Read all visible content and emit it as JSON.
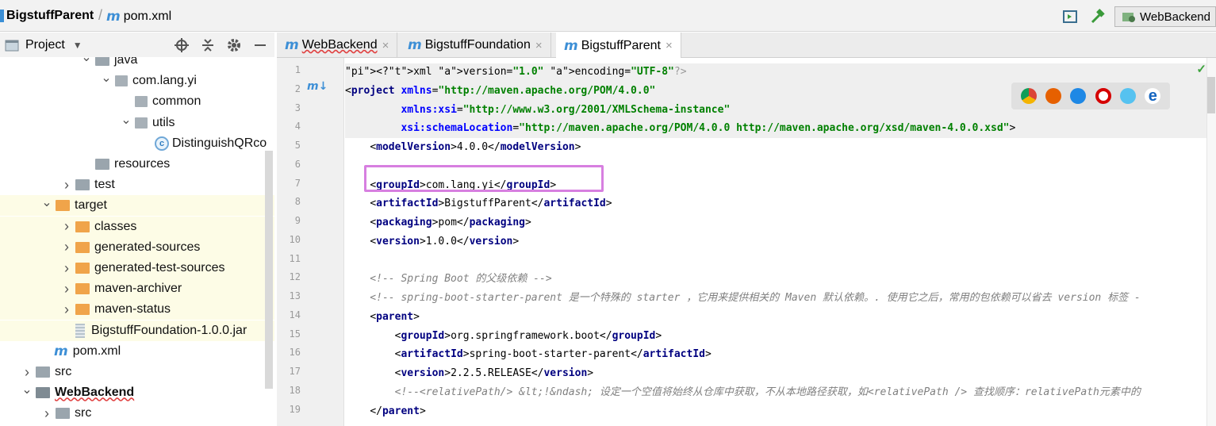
{
  "breadcrumb": {
    "project": "BigstuffParent",
    "file": "pom.xml"
  },
  "toolbar": {
    "run_config": "WebBackend"
  },
  "project_panel": {
    "title": "Project"
  },
  "tree": [
    {
      "label": "java",
      "icon": "source-folder-icon",
      "arrow": "expanded",
      "indent": 0
    },
    {
      "label": "com.lang.yi",
      "icon": "package-icon",
      "arrow": "expanded",
      "indent": 1
    },
    {
      "label": "common",
      "icon": "package-icon",
      "arrow": "none",
      "indent": 2
    },
    {
      "label": "utils",
      "icon": "package-icon",
      "arrow": "expanded",
      "indent": 2
    },
    {
      "label": "DistinguishQRco",
      "icon": "class-icon",
      "arrow": "none",
      "indent": 3
    },
    {
      "label": "resources",
      "icon": "resources-folder-icon",
      "arrow": "none",
      "indent": 0
    },
    {
      "label": "test",
      "icon": "folder-icon",
      "arrow": "collapsed",
      "indent": -1
    },
    {
      "label": "target",
      "icon": "orange-folder-icon",
      "arrow": "expanded",
      "indent": -2
    },
    {
      "label": "classes",
      "icon": "orange-folder-icon",
      "arrow": "collapsed",
      "indent": -1
    },
    {
      "label": "generated-sources",
      "icon": "orange-folder-icon",
      "arrow": "collapsed",
      "indent": -1
    },
    {
      "label": "generated-test-sources",
      "icon": "orange-folder-icon",
      "arrow": "collapsed",
      "indent": -1
    },
    {
      "label": "maven-archiver",
      "icon": "orange-folder-icon",
      "arrow": "collapsed",
      "indent": -1
    },
    {
      "label": "maven-status",
      "icon": "orange-folder-icon",
      "arrow": "collapsed",
      "indent": -1
    },
    {
      "label": "BigstuffFoundation-1.0.0.jar",
      "icon": "jar-icon",
      "arrow": "none",
      "indent": -1
    },
    {
      "label": "pom.xml",
      "icon": "maven-icon",
      "arrow": "none",
      "indent": -2
    },
    {
      "label": "src",
      "icon": "folder-icon",
      "arrow": "collapsed",
      "indent": -3
    },
    {
      "label": "WebBackend",
      "icon": "module-icon",
      "arrow": "expanded",
      "indent": -3
    },
    {
      "label": "src",
      "icon": "folder-icon",
      "arrow": "collapsed",
      "indent": -2
    }
  ],
  "tabs": [
    {
      "label": "WebBackend",
      "active": false
    },
    {
      "label": "BigstuffFoundation",
      "active": false
    },
    {
      "label": "BigstuffParent",
      "active": true
    }
  ],
  "editor": {
    "line_numbers": [
      "1",
      "2",
      "3",
      "4",
      "5",
      "6",
      "7",
      "8",
      "9",
      "10",
      "11",
      "12",
      "13",
      "14",
      "15",
      "16",
      "17",
      "18",
      "19"
    ],
    "lines": [
      "<?xml version=\"1.0\" encoding=\"UTF-8\"?>",
      "<project xmlns=\"http://maven.apache.org/POM/4.0.0\"",
      "         xmlns:xsi=\"http://www.w3.org/2001/XMLSchema-instance\"",
      "         xsi:schemaLocation=\"http://maven.apache.org/POM/4.0.0 http://maven.apache.org/xsd/maven-4.0.0.xsd\">",
      "    <modelVersion>4.0.0</modelVersion>",
      "",
      "    <groupId>com.lang.yi</groupId>",
      "    <artifactId>BigstuffParent</artifactId>",
      "    <packaging>pom</packaging>",
      "    <version>1.0.0</version>",
      "",
      "    <!-- Spring Boot 的父级依赖 -->",
      "    <!-- spring-boot-starter-parent 是一个特殊的 starter ，它用来提供相关的 Maven 默认依赖。. 使用它之后，常用的包依赖可以省去 version 标签 -",
      "    <parent>",
      "        <groupId>org.springframework.boot</groupId>",
      "        <artifactId>spring-boot-starter-parent</artifactId>",
      "        <version>2.2.5.RELEASE</version>",
      "        <!--<relativePath/> &lt;!&ndash; 设定一个空值将始终从仓库中获取，不从本地路径获取，如<relativePath /> 查找顺序：relativePath元素中的",
      "    </parent>"
    ]
  },
  "browsers": [
    "chrome-icon",
    "firefox-icon",
    "safari-icon",
    "opera-icon",
    "internet-explorer-icon",
    "edge-icon"
  ]
}
